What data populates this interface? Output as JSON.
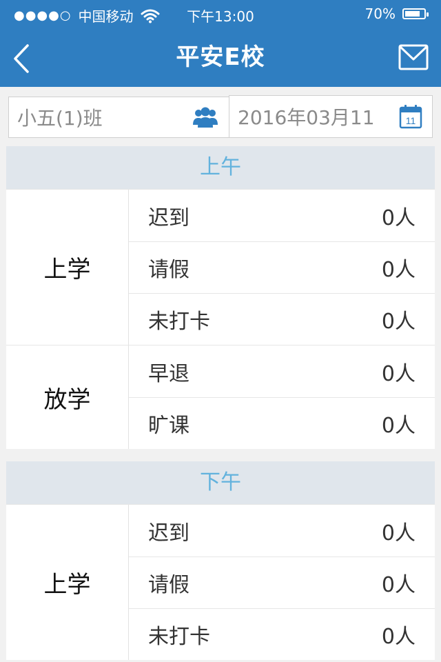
{
  "status_bar": {
    "signal": "●●●●○",
    "carrier": "中国移动",
    "time": "下午13:00",
    "battery": "70%"
  },
  "nav": {
    "title": "平安E校",
    "back_icon": "chevron-left-icon",
    "mail_icon": "mail-icon"
  },
  "filters": {
    "class_value": "小五(1)班",
    "date_value": "2016年03月11",
    "calendar_day": "11"
  },
  "colors": {
    "primary": "#2f7ec1",
    "section_header_bg": "#e0e6ec",
    "section_header_text": "#62b2dd"
  },
  "sections": [
    {
      "title": "上午",
      "groups": [
        {
          "label": "上学",
          "items": [
            {
              "name": "迟到",
              "value": "0人"
            },
            {
              "name": "请假",
              "value": "0人"
            },
            {
              "name": "未打卡",
              "value": "0人"
            }
          ]
        },
        {
          "label": "放学",
          "items": [
            {
              "name": "早退",
              "value": "0人"
            },
            {
              "name": "旷课",
              "value": "0人"
            }
          ]
        }
      ]
    },
    {
      "title": "下午",
      "groups": [
        {
          "label": "上学",
          "items": [
            {
              "name": "迟到",
              "value": "0人"
            },
            {
              "name": "请假",
              "value": "0人"
            },
            {
              "name": "未打卡",
              "value": "0人"
            }
          ]
        }
      ]
    }
  ]
}
